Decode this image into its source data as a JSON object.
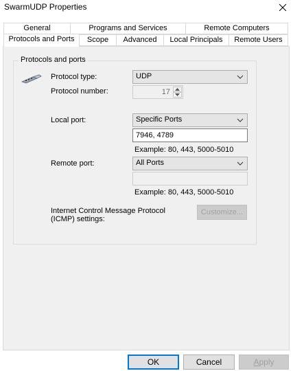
{
  "window": {
    "title": "SwarmUDP Properties"
  },
  "tabs_row1": [
    {
      "label": "General"
    },
    {
      "label": "Programs and Services"
    },
    {
      "label": "Remote Computers"
    }
  ],
  "tabs_row2": [
    {
      "label": "Protocols and Ports",
      "active": true
    },
    {
      "label": "Scope"
    },
    {
      "label": "Advanced"
    },
    {
      "label": "Local Principals"
    },
    {
      "label": "Remote Users"
    }
  ],
  "group": {
    "title": "Protocols and ports"
  },
  "protocol_type": {
    "label": "Protocol type:",
    "value": "UDP"
  },
  "protocol_number": {
    "label": "Protocol number:",
    "value": "17"
  },
  "local_port": {
    "label": "Local port:",
    "value": "Specific Ports",
    "ports": "7946, 4789",
    "example": "Example: 80, 443, 5000-5010"
  },
  "remote_port": {
    "label": "Remote port:",
    "value": "All Ports",
    "ports": "",
    "example": "Example: 80, 443, 5000-5010"
  },
  "icmp": {
    "label_line1": "Internet Control Message Protocol",
    "label_line2": "(ICMP) settings:",
    "button": "Customize..."
  },
  "footer": {
    "ok": "OK",
    "cancel": "Cancel",
    "apply_first": "A",
    "apply_rest": "pply"
  },
  "colors": {
    "accent": "#0078d7",
    "panel": "#f0f0f0"
  }
}
